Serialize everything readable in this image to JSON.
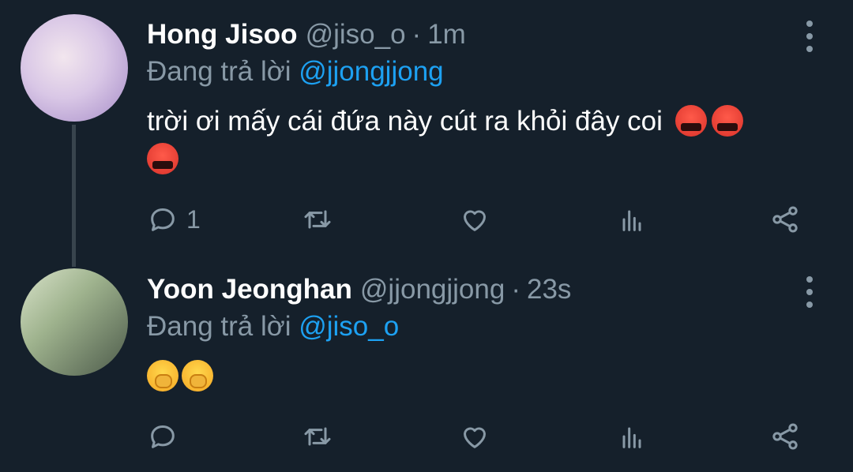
{
  "tweets": [
    {
      "name": "Hong Jisoo",
      "handle": "@jiso_o",
      "time": "1m",
      "replying_prefix": "Đang trả lời",
      "replying_to": "@jjongjjong",
      "text": "trời ơi mấy cái đứa này cút ra khỏi đây coi",
      "emojis": [
        "angry-cursing-face",
        "angry-cursing-face",
        "angry-cursing-face"
      ],
      "reply_count": "1"
    },
    {
      "name": "Yoon Jeonghan",
      "handle": "@jjongjjong",
      "time": "23s",
      "replying_prefix": "Đang trả lời",
      "replying_to": "@jiso_o",
      "text": "",
      "emojis": [
        "giggle-hand-over-mouth",
        "giggle-hand-over-mouth"
      ],
      "reply_count": ""
    }
  ],
  "separator": "·",
  "icons": [
    "reply-icon",
    "retweet-icon",
    "like-icon",
    "stats-icon",
    "share-icon",
    "more-icon"
  ],
  "colors": {
    "background": "#15202b",
    "secondary_text": "#8899a6",
    "link": "#1da1f2",
    "primary_text": "#ffffff"
  }
}
